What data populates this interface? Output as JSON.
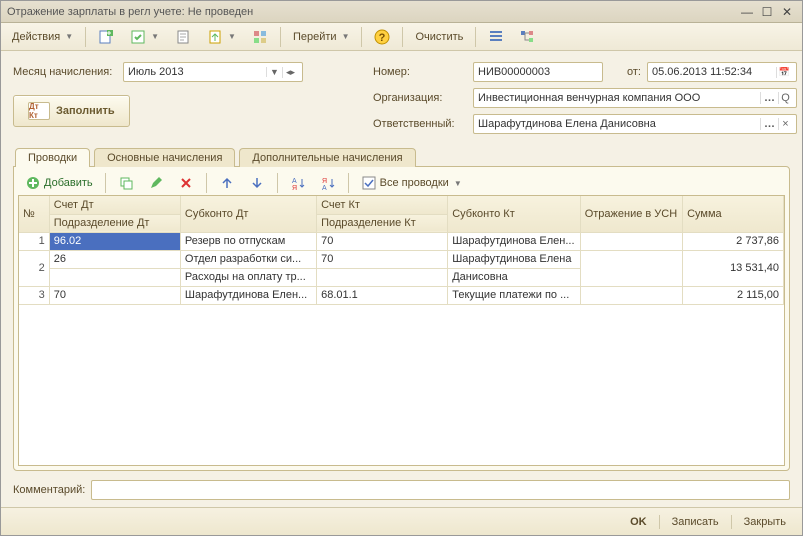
{
  "window": {
    "title": "Отражение зарплаты в регл учете: Не проведен"
  },
  "toolbar": {
    "actions": "Действия",
    "goto": "Перейти",
    "clear": "Очистить"
  },
  "form": {
    "month_label": "Месяц начисления:",
    "month_value": "Июль 2013",
    "number_label": "Номер:",
    "number_value": "НИВ00000003",
    "from_label": "от:",
    "date_value": "05.06.2013 11:52:34",
    "org_label": "Организация:",
    "org_value": "Инвестиционная венчурная компания ООО",
    "resp_label": "Ответственный:",
    "resp_value": "Шарафутдинова Елена Данисовна",
    "fill_button": "Заполнить",
    "comment_label": "Комментарий:",
    "comment_value": ""
  },
  "tabs": {
    "t1": "Проводки",
    "t2": "Основные начисления",
    "t3": "Дополнительные начисления"
  },
  "gridtoolbar": {
    "add": "Добавить",
    "all": "Все проводки"
  },
  "grid": {
    "headers": {
      "n": "№",
      "acc_dt": "Счет Дт",
      "dept_dt": "Подразделение Дт",
      "subk_dt": "Субконто Дт",
      "acc_kt": "Счет Кт",
      "dept_kt": "Подразделение Кт",
      "subk_kt": "Субконто Кт",
      "usn": "Отражение в УСН",
      "sum": "Сумма"
    },
    "rows": [
      {
        "n": "1",
        "acc_dt": "96.02",
        "dept_dt": "",
        "subk_dt1": "Резерв по отпускам",
        "subk_dt2": "",
        "acc_kt": "70",
        "dept_kt": "",
        "subk_kt1": "Шарафутдинова Елен...",
        "subk_kt2": "",
        "usn": "",
        "sum": "2 737,86"
      },
      {
        "n": "2",
        "acc_dt": "26",
        "dept_dt": "",
        "subk_dt1": "Отдел разработки си...",
        "subk_dt2": "Расходы на оплату тр...",
        "acc_kt": "70",
        "dept_kt": "",
        "subk_kt1": "Шарафутдинова Елена",
        "subk_kt2": "Данисовна",
        "usn": "",
        "sum": "13 531,40"
      },
      {
        "n": "3",
        "acc_dt": "70",
        "dept_dt": "",
        "subk_dt1": "Шарафутдинова Елен...",
        "subk_dt2": "",
        "acc_kt": "68.01.1",
        "dept_kt": "",
        "subk_kt1": "Текущие платежи по ...",
        "subk_kt2": "",
        "usn": "",
        "sum": "2 115,00"
      }
    ]
  },
  "footer": {
    "ok": "OK",
    "save": "Записать",
    "close": "Закрыть"
  }
}
